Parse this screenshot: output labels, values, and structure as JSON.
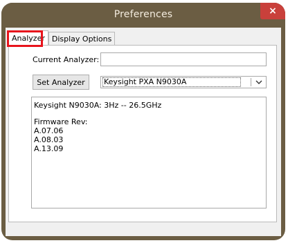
{
  "window": {
    "title": "Preferences",
    "close_glyph": "×"
  },
  "tabs": [
    {
      "label": "Analyzer",
      "active": true
    },
    {
      "label": "Display Options",
      "active": false
    }
  ],
  "analyzer": {
    "current_label": "Current Analyzer:",
    "current_value": "",
    "set_button_label": "Set Analyzer",
    "selected_analyzer": "Keysight PXA N9030A",
    "info": {
      "model_line": "Keysight N9030A: 3Hz -- 26.5GHz",
      "firmware_label": "Firmware Rev:",
      "firmware_versions": [
        "A.07.06",
        "A.08.03",
        "A.13.09"
      ]
    }
  },
  "colors": {
    "titlebar": "#6b5d43",
    "close_button": "#c9403b",
    "highlight": "#e8141c"
  },
  "icons": {
    "dropdown": "chevron-down-icon",
    "close": "close-icon"
  }
}
